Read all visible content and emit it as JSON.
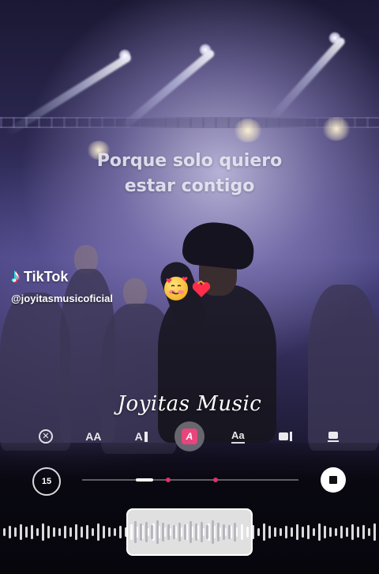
{
  "lyrics": {
    "line1": "Porque solo quiero",
    "line2": "estar contigo"
  },
  "watermark": {
    "brand": "TikTok",
    "handle": "@joyitasmusicoficial"
  },
  "emojis": [
    "smiling-face-with-hearts",
    "heart-on-fire"
  ],
  "caption": "Joyitas Music",
  "toolbar": {
    "tools": [
      {
        "name": "close-style-icon",
        "label": "✕"
      },
      {
        "name": "text-size-icon",
        "label": "AA"
      },
      {
        "name": "text-align-icon",
        "label": "A"
      },
      {
        "name": "text-style-active-icon",
        "label": "A"
      },
      {
        "name": "text-underline-icon",
        "label": "Aa"
      },
      {
        "name": "layout-side-icon",
        "label": ""
      },
      {
        "name": "layout-stack-icon",
        "label": ""
      }
    ],
    "active_tool": "text-style-active-icon"
  },
  "playback": {
    "timer_label": "15",
    "progress_fraction": 0.28
  },
  "colors": {
    "accent": "#e8457c",
    "marker": "#e0306a"
  }
}
